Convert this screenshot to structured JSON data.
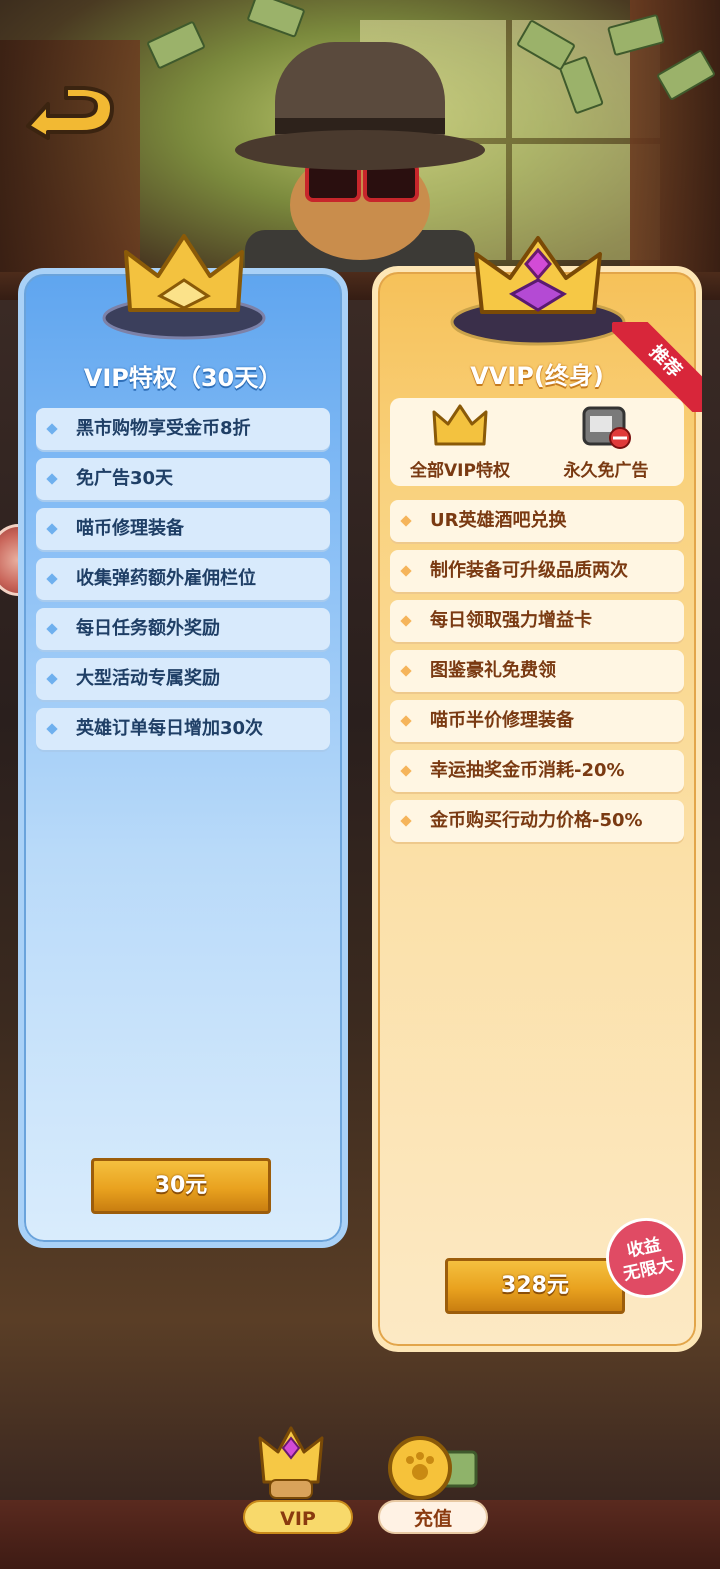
{
  "nav": {
    "back_label": ""
  },
  "vip_card": {
    "title": "VIP特权（30天）",
    "perks": [
      "黑市购物享受金币8折",
      "免广告30天",
      "喵币修理装备",
      "收集弹药额外雇佣栏位",
      "每日任务额外奖励",
      "大型活动专属奖励",
      "英雄订单每日增加30次"
    ],
    "price_label": "30元"
  },
  "vvip_card": {
    "title": "VVIP(终身)",
    "ribbon": "推荐",
    "features": [
      {
        "label": "全部VIP特权",
        "icon": "crown-icon"
      },
      {
        "label": "永久免广告",
        "icon": "no-ads-icon"
      }
    ],
    "perks": [
      "UR英雄酒吧兑换",
      "制作装备可升级品质两次",
      "每日领取强力增益卡",
      "图鉴豪礼免费领",
      "喵币半价修理装备",
      "幸运抽奖金币消耗-20%",
      "金币购买行动力价格-50%"
    ],
    "price_label": "328元",
    "badge_line1": "收益",
    "badge_line2": "无限大"
  },
  "tabs": {
    "vip_label": "VIP",
    "recharge_label": "充值"
  },
  "colors": {
    "vip_blue": "#5fa5ef",
    "vvip_gold": "#f6c159",
    "price_gold": "#e9a21f",
    "ribbon_red": "#d8263a"
  }
}
